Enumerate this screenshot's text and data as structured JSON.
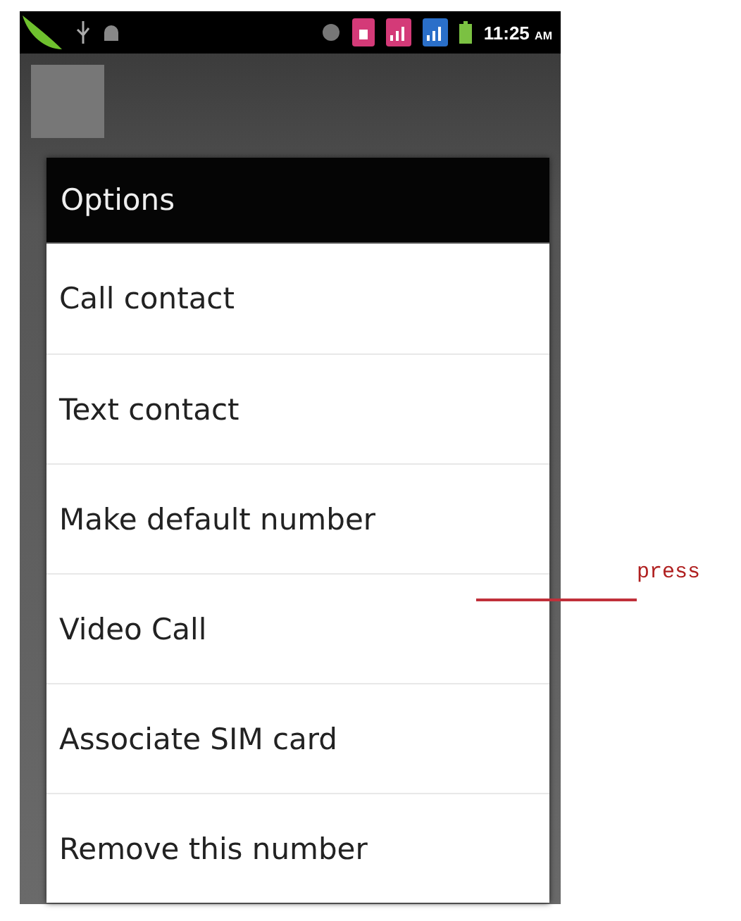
{
  "status_bar": {
    "time": "11:25",
    "ampm": "AM"
  },
  "dialog": {
    "title": "Options",
    "items": [
      {
        "label": "Call contact"
      },
      {
        "label": "Text contact"
      },
      {
        "label": "Make default number"
      },
      {
        "label": "Video Call"
      },
      {
        "label": "Associate SIM card"
      },
      {
        "label": "Remove this number"
      }
    ]
  },
  "annotation": {
    "text": "press"
  }
}
